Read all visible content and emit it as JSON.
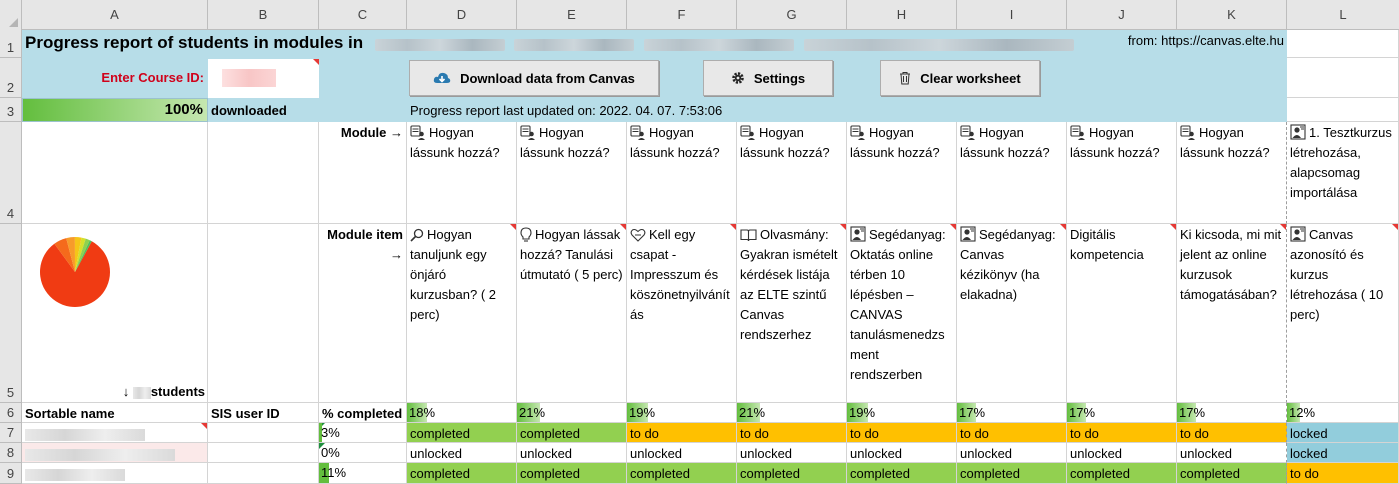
{
  "columns": [
    "A",
    "B",
    "C",
    "D",
    "E",
    "F",
    "G",
    "H",
    "I",
    "J",
    "K",
    "L"
  ],
  "rows": [
    "1",
    "2",
    "3",
    "4",
    "5",
    "6",
    "7",
    "8",
    "9"
  ],
  "title": "Progress report of students in modules in",
  "from_label": "from: https://canvas.elte.hu",
  "course_id_label": "Enter Course ID:",
  "progress": {
    "percent_label": "100%",
    "percent": 100,
    "status": "downloaded"
  },
  "buttons": {
    "download": "Download data from Canvas",
    "settings": "Settings",
    "clear": "Clear worksheet"
  },
  "last_updated": "Progress report last updated on: 2022. 04. 07. 7:53:06",
  "module_label": "Module →",
  "module_item_label": "Module item →",
  "students_label": "students",
  "headers": {
    "name": "Sortable name",
    "sis": "SIS user ID",
    "pct": "% completed"
  },
  "modules": [
    "Hogyan lássunk hozzá?",
    "Hogyan lássunk hozzá?",
    "Hogyan lássunk hozzá?",
    "Hogyan lássunk hozzá?",
    "Hogyan lássunk hozzá?",
    "Hogyan lássunk hozzá?",
    "Hogyan lássunk hozzá?",
    "Hogyan lássunk hozzá?",
    "1. Tesztkurzus létrehozása, alapcsomag importálása"
  ],
  "module_items": [
    "Hogyan tanuljunk egy önjáró kurzusban? ( 2 perc)",
    "Hogyan lássak hozzá? Tanulási útmutató ( 5 perc)",
    "Kell egy csapat - Impresszum és köszönetnyilvánítás",
    "Olvasmány: Gyakran ismételt kérdések listája az ELTE szintű Canvas rendszerhez",
    "Segédanyag: Oktatás online térben 10 lépésben – CANVAS tanulásmenedzsment rendszerben",
    "Segédanyag: Canvas kézikönyv (ha elakadna)",
    "Digitális kompetencia",
    "Ki kicsoda, mi mit jelent az online kurzusok támogatásában?",
    "Canvas azonosító és kurzus létrehozása ( 10 perc)"
  ],
  "module_item_icons": [
    "magnifier-icon",
    "lightbulb-icon",
    "heart-icon",
    "book-icon",
    "person-board-icon",
    "person-board-icon",
    "",
    "",
    "person-board-icon"
  ],
  "completion_pct": [
    "18%",
    "21%",
    "19%",
    "21%",
    "19%",
    "17%",
    "17%",
    "17%",
    "12%"
  ],
  "completion_values": [
    18,
    21,
    19,
    21,
    19,
    17,
    17,
    17,
    12
  ],
  "students": [
    {
      "pct": "3%",
      "statuses": [
        "completed",
        "completed",
        "to do",
        "to do",
        "to do",
        "to do",
        "to do",
        "to do",
        "locked"
      ]
    },
    {
      "pct": "0%",
      "statuses": [
        "unlocked",
        "unlocked",
        "unlocked",
        "unlocked",
        "unlocked",
        "unlocked",
        "unlocked",
        "unlocked",
        "locked"
      ]
    },
    {
      "pct": "11%",
      "statuses": [
        "completed",
        "completed",
        "completed",
        "completed",
        "completed",
        "completed",
        "completed",
        "completed",
        "to do"
      ]
    }
  ],
  "colors": {
    "blue_band": "#b7dde8",
    "todo": "#ffc000",
    "completed": "#92d050",
    "locked": "#92cddc",
    "label_red": "#d0021b"
  },
  "chart_data": {
    "type": "pie",
    "values": [
      82,
      6,
      4,
      3,
      2,
      2,
      1
    ],
    "colors": [
      "#f03b13",
      "#f56a1c",
      "#f79b2a",
      "#f5c518",
      "#d6e02a",
      "#8fd14f",
      "#4fc05a"
    ]
  }
}
